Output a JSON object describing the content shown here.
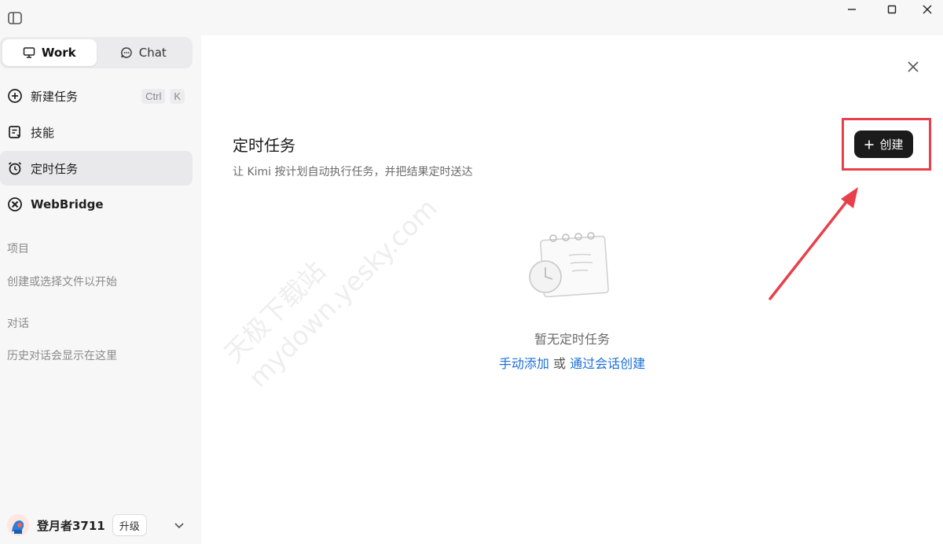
{
  "window": {
    "minimize_icon": "minimize-icon",
    "maximize_icon": "maximize-icon",
    "close_icon": "close-icon"
  },
  "sidebar": {
    "modes": [
      {
        "label": "Work",
        "icon": "monitor-icon",
        "active": true
      },
      {
        "label": "Chat",
        "icon": "chat-bubble-icon",
        "active": false
      }
    ],
    "items": [
      {
        "label": "新建任务",
        "icon": "plus-circle-icon",
        "shortcut": [
          "Ctrl",
          "K"
        ]
      },
      {
        "label": "技能",
        "icon": "skill-icon"
      },
      {
        "label": "定时任务",
        "icon": "alarm-clock-icon",
        "active": true
      },
      {
        "label": "WebBridge",
        "icon": "webbridge-icon"
      }
    ],
    "projects": {
      "title": "项目",
      "hint": "创建或选择文件以开始"
    },
    "conversations": {
      "title": "对话",
      "hint": "历史对话会显示在这里"
    },
    "user": {
      "name": "登月者3711",
      "upgrade": "升级"
    }
  },
  "main": {
    "title": "定时任务",
    "subtitle": "让 Kimi 按计划自动执行任务，并把结果定时送达",
    "create_button": "创建",
    "empty": {
      "message": "暂无定时任务",
      "action_manual": "手动添加",
      "connector": "或",
      "action_chat": "通过会话创建"
    },
    "watermark": [
      "天极下载站",
      "mydown.yesky.com"
    ]
  },
  "colors": {
    "accent_link": "#1e6fd9",
    "annotation_red": "#e8404a",
    "create_button_bg": "#1b1b1b"
  }
}
